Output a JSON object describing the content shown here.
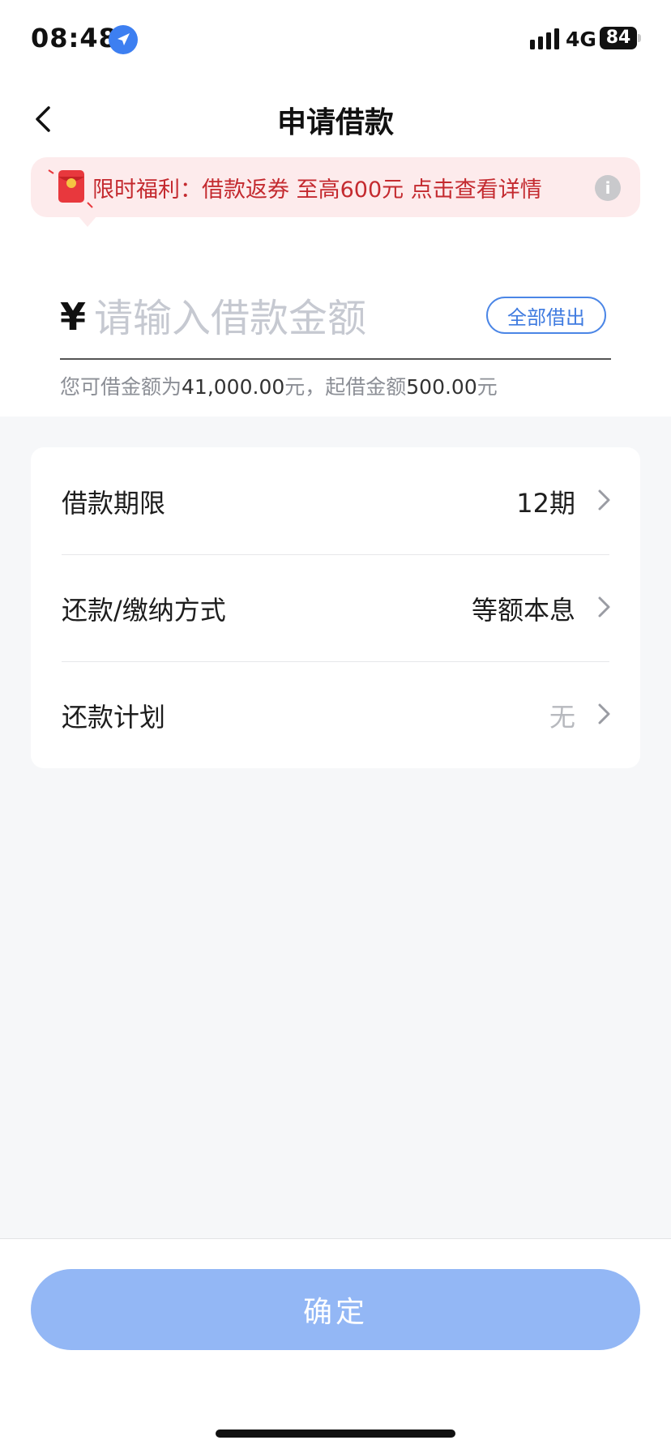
{
  "status_bar": {
    "time": "08:48",
    "network": "4G",
    "battery": "84"
  },
  "nav": {
    "title": "申请借款"
  },
  "promo": {
    "text": "限时福利：借款返券 至高600元 点击查看详情",
    "info_symbol": "i"
  },
  "amount": {
    "currency": "¥",
    "placeholder": "请输入借款金额",
    "borrow_all_label": "全部借出",
    "hint_prefix": "您可借金额为",
    "available": "41,000.00",
    "hint_mid": "元，起借金额",
    "minimum": "500.00",
    "hint_suffix": "元"
  },
  "settings": {
    "rows": [
      {
        "label": "借款期限",
        "value": "12期"
      },
      {
        "label": "还款/缴纳方式",
        "value": "等额本息"
      },
      {
        "label": "还款计划",
        "value": "无"
      }
    ]
  },
  "footer": {
    "confirm_label": "确定"
  },
  "colors": {
    "accent": "#4b86e6",
    "confirm_disabled": "#93b7f5",
    "promo_bg": "#fdebec",
    "promo_text": "#c42a2f"
  }
}
